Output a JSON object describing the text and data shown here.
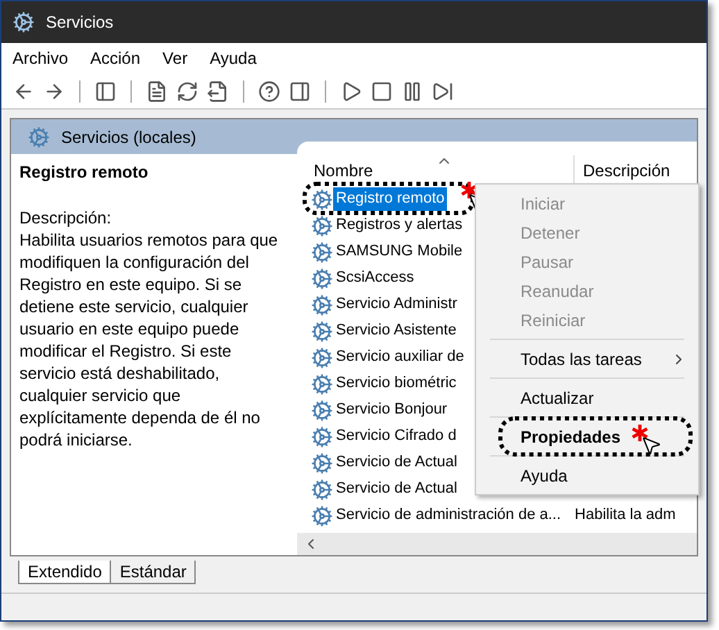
{
  "window": {
    "title": "Servicios"
  },
  "menu": [
    "Archivo",
    "Acción",
    "Ver",
    "Ayuda"
  ],
  "tree_header": "Servicios (locales)",
  "details": {
    "title": "Registro remoto",
    "label": "Descripción:",
    "text": "Habilita usuarios remotos para que modifiquen la configuración del Registro en este equipo. Si se detiene este servicio, cualquier usuario en este equipo puede modificar el Registro. Si este servicio está deshabilitado, cualquier servicio que explícitamente dependa de él no podrá iniciarse."
  },
  "table": {
    "columns": [
      "Nombre",
      "Descripción"
    ],
    "rows": [
      {
        "name": "Registro remoto",
        "selected": true,
        "highlighted": true
      },
      {
        "name": "Registros y alertas",
        "selected": false,
        "highlighted": false
      },
      {
        "name": "SAMSUNG Mobile",
        "selected": false,
        "highlighted": false
      },
      {
        "name": "ScsiAccess",
        "selected": false,
        "highlighted": false
      },
      {
        "name": "Servicio Administr",
        "selected": false,
        "highlighted": false
      },
      {
        "name": "Servicio Asistente",
        "selected": false,
        "highlighted": false
      },
      {
        "name": "Servicio auxiliar de",
        "selected": false,
        "highlighted": false
      },
      {
        "name": "Servicio biométric",
        "selected": false,
        "highlighted": false
      },
      {
        "name": "Servicio Bonjour",
        "selected": false,
        "highlighted": false
      },
      {
        "name": "Servicio Cifrado d",
        "selected": false,
        "highlighted": false
      },
      {
        "name": "Servicio de Actual",
        "selected": false,
        "highlighted": false
      },
      {
        "name": "Servicio de Actual",
        "selected": false,
        "highlighted": false
      },
      {
        "name": "Servicio de administración de a...",
        "description": "Habilita la adm",
        "selected": false,
        "highlighted": false
      }
    ]
  },
  "context_menu": [
    {
      "kind": "item",
      "label": "Iniciar",
      "disabled": true
    },
    {
      "kind": "item",
      "label": "Detener",
      "disabled": true
    },
    {
      "kind": "item",
      "label": "Pausar",
      "disabled": true
    },
    {
      "kind": "item",
      "label": "Reanudar",
      "disabled": true
    },
    {
      "kind": "item",
      "label": "Reiniciar",
      "disabled": true
    },
    {
      "kind": "separator"
    },
    {
      "kind": "submenu",
      "label": "Todas las tareas",
      "disabled": false
    },
    {
      "kind": "separator"
    },
    {
      "kind": "item",
      "label": "Actualizar",
      "disabled": false
    },
    {
      "kind": "separator"
    },
    {
      "kind": "default",
      "label": "Propiedades",
      "disabled": false,
      "highlighted": true
    },
    {
      "kind": "separator"
    },
    {
      "kind": "item",
      "label": "Ayuda",
      "disabled": false
    }
  ],
  "bottom_tabs": [
    {
      "label": "Extendido",
      "selected": true
    },
    {
      "label": "Estándar",
      "selected": false
    }
  ]
}
